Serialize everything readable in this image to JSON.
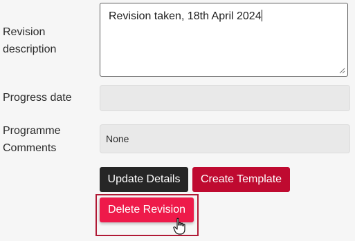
{
  "form": {
    "revision_description": {
      "label": "Revision description",
      "value": "Revision taken, 18th April 2024"
    },
    "progress_date": {
      "label": "Progress date",
      "value": ""
    },
    "programme_comments": {
      "label": "Programme Comments",
      "value": "None"
    }
  },
  "buttons": {
    "update_details": "Update Details",
    "create_template": "Create Template",
    "delete_revision": "Delete Revision"
  },
  "colors": {
    "update_button": "#262626",
    "create_template_button": "#bf0a30",
    "delete_button": "#ee1a4a",
    "highlight_border": "#b01935"
  },
  "icons": {
    "cursor": "hand-pointer-icon"
  }
}
